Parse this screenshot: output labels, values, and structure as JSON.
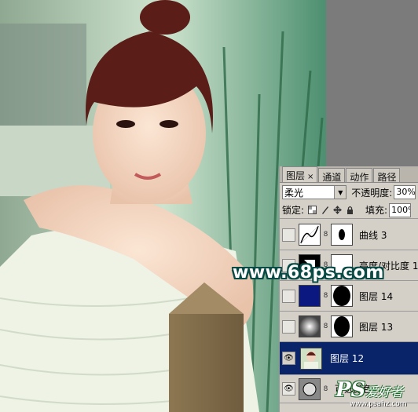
{
  "colors": {
    "selected_row": "#0a246a",
    "panel_bg": "#d4d0c8",
    "watermark_outline": "#0a4a44"
  },
  "panel": {
    "tabs": [
      {
        "label": "图层",
        "close": "×",
        "active": true
      },
      {
        "label": "通道",
        "active": false
      },
      {
        "label": "动作",
        "active": false
      },
      {
        "label": "路径",
        "active": false
      }
    ],
    "blend_mode": "柔光",
    "opacity_label": "不透明度:",
    "opacity_value": "30%",
    "lock_label": "锁定:",
    "lock_icons": [
      "transparent-lock-icon",
      "brush-lock-icon",
      "move-lock-icon",
      "padlock-icon"
    ],
    "fill_label": "填充:",
    "fill_value": "100%",
    "layers": [
      {
        "name": "曲线 3",
        "type": "curves",
        "visible": false,
        "selected": false
      },
      {
        "name": "亮度/对比度 1",
        "type": "brightness-contrast",
        "visible": false,
        "selected": false
      },
      {
        "name": "图层 14",
        "type": "solid-blue",
        "visible": false,
        "selected": false
      },
      {
        "name": "图层 13",
        "type": "gradient",
        "visible": false,
        "selected": false
      },
      {
        "name": "图层 12",
        "type": "photo",
        "visible": true,
        "selected": true
      },
      {
        "name": "可选颜色",
        "type": "selective-color",
        "visible": true,
        "selected": false
      }
    ]
  },
  "watermarks": {
    "site": "www.68ps.com",
    "logo_ps": "PS",
    "logo_cn": "爱好者",
    "logo_url": "www.psahz.com"
  }
}
